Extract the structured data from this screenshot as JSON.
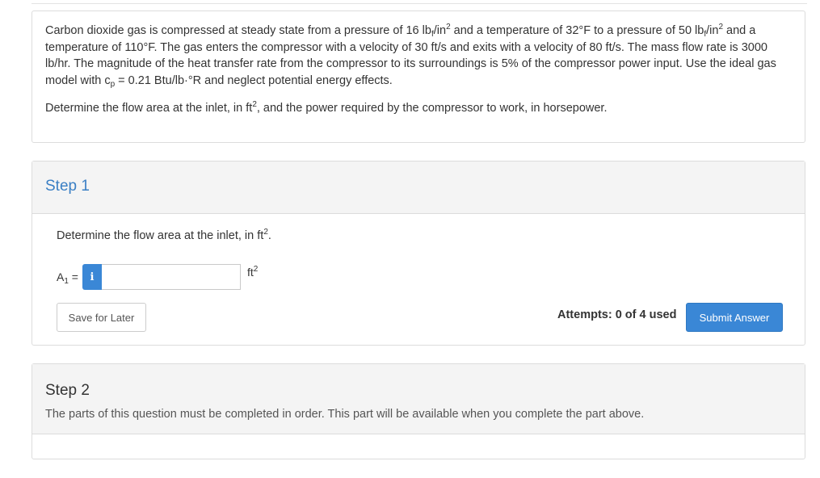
{
  "problem": {
    "line1_a": "Carbon dioxide gas is compressed at steady state from a pressure of 16 lb",
    "line1_sub": "f",
    "line1_b": "/in",
    "line1_sup": "2",
    "line1_c": " and a temperature of 32°F to a pressure of 50 lb",
    "line1_sub2": "f",
    "line1_d": "/in",
    "line1_sup2": "2",
    "line2": "and a temperature of 110°F. The gas enters the compressor with a velocity of 30 ft/s and exits with a velocity of 80 ft/s. The mass flow rate is 3000 lb/hr. The magnitude of the heat transfer rate from the compressor to its surroundings is 5% of the compressor power input. Use the ideal gas model with c",
    "cp_sub": "p",
    "line3": " = 0.21 Btu/lb·°R and neglect potential energy effects.",
    "question_a": "Determine the flow area at the inlet, in ft",
    "question_sup": "2",
    "question_b": ", and the power required by the compressor to work, in horsepower."
  },
  "step1": {
    "title": "Step 1",
    "instruction_a": "Determine the flow area at the inlet, in ft",
    "instruction_sup": "2",
    "instruction_b": ".",
    "var_name": "A",
    "var_sub": "1",
    "var_eq": " =",
    "info_icon": "i",
    "input_value": "",
    "unit": "ft",
    "unit_sup": "2",
    "save_label": "Save for Later",
    "attempts": "Attempts: 0 of 4 used",
    "submit_label": "Submit Answer"
  },
  "step2": {
    "title": "Step 2",
    "note": "The parts of this question must be completed in order. This part will be available when you complete the part above."
  },
  "colors": {
    "accent": "#3a87d6",
    "step1_title": "#3a7fc4",
    "header_bg": "#f4f4f4",
    "border": "#dcdcdc"
  }
}
